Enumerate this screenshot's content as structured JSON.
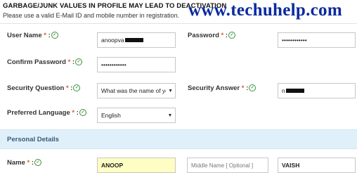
{
  "banner": {
    "warning": "GARBAGE/JUNK VALUES IN PROFILE MAY LEAD TO DEACTIVATION",
    "subtext": "Please use a valid E-Mail ID and mobile number in registration.",
    "watermark": "www.techuhelp.com"
  },
  "form": {
    "username": {
      "label": "User Name",
      "required": "*",
      "sep": ":",
      "value": "anoopva"
    },
    "password": {
      "label": "Password",
      "required": "*",
      "sep": ":",
      "value": "••••••••••••"
    },
    "confirm_password": {
      "label": "Confirm Password",
      "required": "*",
      "sep": ":",
      "value": "••••••••••••"
    },
    "security_question": {
      "label": "Security Question",
      "required": "*",
      "sep": ":",
      "value": "What was the name of you"
    },
    "security_answer": {
      "label": "Security Answer",
      "required": "*",
      "sep": ":",
      "value": "n"
    },
    "preferred_language": {
      "label": "Preferred Language",
      "required": "*",
      "sep": ":",
      "value": "English"
    }
  },
  "personal": {
    "section_title": "Personal Details",
    "name": {
      "label": "Name",
      "required": "*",
      "sep": ":"
    },
    "first_name": "ANOOP",
    "middle_name_placeholder": "Middle Name  [ Optional ]",
    "last_name": "VAISH"
  },
  "icons": {
    "check": "✓",
    "dropdown": "▼"
  },
  "colors": {
    "required": "#e05a3a",
    "check": "#3a8f3a",
    "watermark": "#0a2a9e",
    "section_bg": "#dff0fb",
    "highlight": "#fdfdc4"
  }
}
